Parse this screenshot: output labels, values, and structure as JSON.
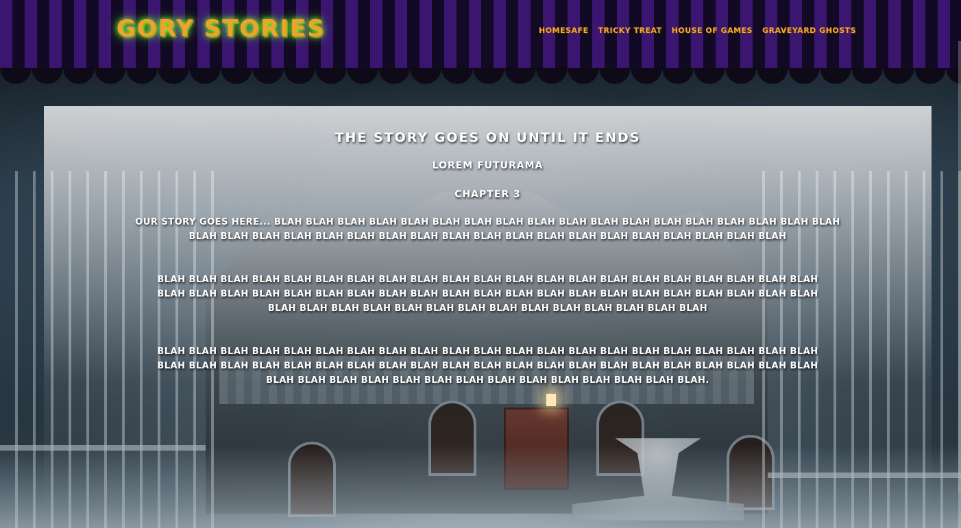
{
  "site": {
    "logo": "GORY STORIES"
  },
  "nav": {
    "items": [
      {
        "label": "HOMESAFE"
      },
      {
        "label": "TRICKY TREAT"
      },
      {
        "label": "HOUSE OF GAMES"
      },
      {
        "label": "GRAVEYARD GHOSTS"
      }
    ]
  },
  "story": {
    "title": "THE STORY GOES ON UNTIL IT ENDS",
    "author": "LOREM FUTURAMA",
    "chapter": "CHAPTER 3",
    "paragraphs": [
      "OUR STORY GOES HERE... BLAH BLAH BLAH BLAH BLAH BLAH BLAH BLAH BLAH BLAH BLAH BLAH BLAH BLAH BLAH BLAH BLAH BLAH BLAH BLAH BLAH BLAH BLAH BLAH BLAH BLAH BLAH BLAH BLAH BLAH BLAH BLAH BLAH BLAH BLAH BLAH BLAH",
      "BLAH BLAH BLAH BLAH BLAH BLAH BLAH BLAH BLAH BLAH BLAH BLAH BLAH BLAH BLAH BLAH BLAH BLAH BLAH BLAH BLAH BLAH BLAH BLAH BLAH BLAH BLAH BLAH BLAH BLAH BLAH BLAH BLAH BLAH BLAH BLAH BLAH BLAH BLAH BLAH BLAH BLAH BLAH BLAH BLAH BLAH BLAH BLAH BLAH BLAH BLAH BLAH BLAH BLAH BLAH BLAH",
      "BLAH BLAH BLAH BLAH BLAH BLAH BLAH BLAH BLAH BLAH BLAH BLAH BLAH BLAH BLAH BLAH BLAH BLAH BLAH BLAH BLAH BLAH BLAH BLAH BLAH BLAH BLAH BLAH BLAH BLAH BLAH BLAH BLAH BLAH BLAH BLAH BLAH BLAH BLAH BLAH BLAH BLAH BLAH BLAH BLAH BLAH BLAH BLAH BLAH BLAH BLAH BLAH BLAH BLAH BLAH BLAH."
    ]
  },
  "colors": {
    "header_stripe_a": "#3a1670",
    "header_stripe_b": "#120924",
    "logo": "#f0a22a",
    "logo_glow": "#7cff3a",
    "nav_link": "#f2a93a",
    "story_text": "#ffffff"
  }
}
